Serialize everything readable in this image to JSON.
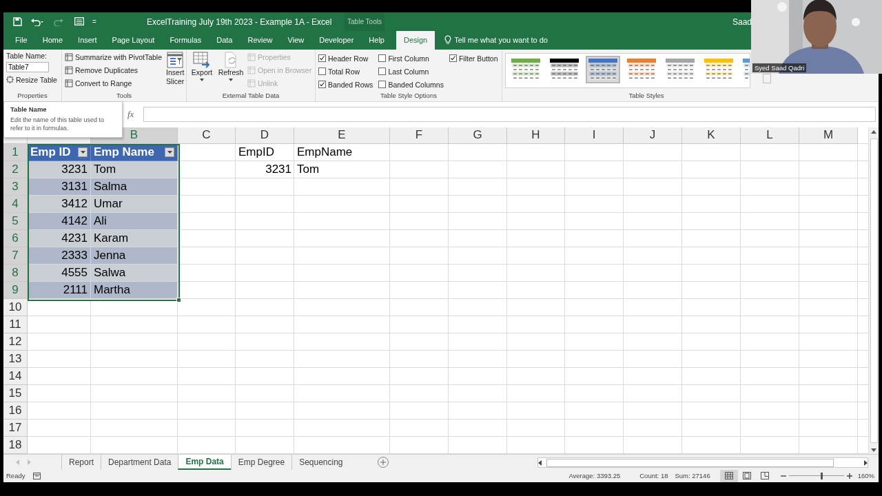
{
  "title_bar": {
    "title": "ExcelTraining July 19th 2023 - Example 1A  -  Excel",
    "context_label": "Table Tools",
    "user": "Saad",
    "customize": "="
  },
  "tabs": [
    {
      "label": "File",
      "selected": false
    },
    {
      "label": "Home",
      "selected": false
    },
    {
      "label": "Insert",
      "selected": false
    },
    {
      "label": "Page Layout",
      "selected": false
    },
    {
      "label": "Formulas",
      "selected": false
    },
    {
      "label": "Data",
      "selected": false
    },
    {
      "label": "Review",
      "selected": false
    },
    {
      "label": "View",
      "selected": false
    },
    {
      "label": "Developer",
      "selected": false
    },
    {
      "label": "Help",
      "selected": false
    },
    {
      "label": "Design",
      "selected": true
    }
  ],
  "tell_me": "Tell me what you want to do",
  "ribbon": {
    "properties": {
      "label": "Table Name:",
      "table_name": "Table7",
      "resize": "Resize Table",
      "group": "Properties"
    },
    "tools": {
      "buttons": [
        "Summarize with PivotTable",
        "Remove Duplicates",
        "Convert to Range"
      ],
      "slicer": "Insert Slicer",
      "group": "Tools"
    },
    "external": {
      "export": "Export",
      "refresh": "Refresh",
      "buttons": [
        {
          "label": "Properties",
          "disabled": true
        },
        {
          "label": "Open in Browser",
          "disabled": true
        },
        {
          "label": "Unlink",
          "disabled": true
        }
      ],
      "group": "External Table Data"
    },
    "style_options": {
      "options": [
        {
          "label": "Header Row",
          "checked": true
        },
        {
          "label": "Total Row",
          "checked": false
        },
        {
          "label": "Banded Rows",
          "checked": true
        },
        {
          "label": "First Column",
          "checked": false
        },
        {
          "label": "Last Column",
          "checked": false
        },
        {
          "label": "Banded Columns",
          "checked": false
        },
        {
          "label": "Filter Button",
          "checked": true
        }
      ],
      "group": "Table Style Options"
    },
    "table_styles": {
      "items": [
        {
          "color": "#70ad47",
          "selected": false
        },
        {
          "color": "#000000",
          "selected": false
        },
        {
          "color": "#4472c4",
          "selected": true
        },
        {
          "color": "#ed7d31",
          "selected": false
        },
        {
          "color": "#a5a5a5",
          "selected": false
        },
        {
          "color": "#ffc000",
          "selected": false
        },
        {
          "color": "#5b9bd5",
          "selected": false
        }
      ],
      "group": "Table Styles"
    }
  },
  "tooltip": {
    "title": "Table Name",
    "text": "Edit the name of this table used to refer to it in formulas."
  },
  "formula_bar": {
    "fx": "fx"
  },
  "sheet": {
    "columns": [
      {
        "label": "B",
        "selected": true
      },
      {
        "label": "C",
        "selected": false
      },
      {
        "label": "D",
        "selected": false,
        "cells": [
          {
            "text": "EmpID",
            "kind": "text"
          },
          {
            "text": "3231",
            "kind": "number"
          }
        ]
      },
      {
        "label": "E",
        "selected": false,
        "cells": [
          {
            "text": "EmpName",
            "kind": "text"
          },
          {
            "text": "Tom",
            "kind": "text"
          }
        ]
      },
      {
        "label": "F",
        "selected": false
      },
      {
        "label": "G",
        "selected": false
      },
      {
        "label": "H",
        "selected": false
      },
      {
        "label": "I",
        "selected": false
      },
      {
        "label": "J",
        "selected": false
      },
      {
        "label": "K",
        "selected": false
      },
      {
        "label": "L",
        "selected": false
      },
      {
        "label": "M",
        "selected": false
      }
    ],
    "rows": [
      {
        "label": "1",
        "selected": true
      },
      {
        "label": "2",
        "selected": true
      },
      {
        "label": "3",
        "selected": true
      },
      {
        "label": "4",
        "selected": true
      },
      {
        "label": "5",
        "selected": true
      },
      {
        "label": "6",
        "selected": true
      },
      {
        "label": "7",
        "selected": true
      },
      {
        "label": "8",
        "selected": true
      },
      {
        "label": "9",
        "selected": true
      },
      {
        "label": "10",
        "selected": false
      },
      {
        "label": "11",
        "selected": false
      },
      {
        "label": "12",
        "selected": false
      },
      {
        "label": "13",
        "selected": false
      },
      {
        "label": "14",
        "selected": false
      },
      {
        "label": "15",
        "selected": false
      },
      {
        "label": "16",
        "selected": false
      },
      {
        "label": "17",
        "selected": false
      },
      {
        "label": "18",
        "selected": false
      }
    ],
    "table": {
      "headers": [
        "Emp ID",
        "Emp Name"
      ],
      "rows": [
        [
          "3231",
          "Tom"
        ],
        [
          "3131",
          "Salma"
        ],
        [
          "3412",
          "Umar"
        ],
        [
          "4142",
          "Ali"
        ],
        [
          "4231",
          "Karam"
        ],
        [
          "2333",
          "Jenna"
        ],
        [
          "4555",
          "Salwa"
        ],
        [
          "2111",
          "Martha"
        ]
      ]
    }
  },
  "sheet_tabs": [
    {
      "label": "Report",
      "selected": false
    },
    {
      "label": "Department Data",
      "selected": false
    },
    {
      "label": "Emp Data",
      "selected": true
    },
    {
      "label": "Emp Degree",
      "selected": false
    },
    {
      "label": "Sequencing",
      "selected": false
    }
  ],
  "status_bar": {
    "ready": "Ready",
    "average": "Average: 3393.25",
    "count": "Count: 18",
    "sum": "Sum: 27146",
    "zoom": "160%",
    "zoom_slider": {
      "level": 0.6
    }
  },
  "webcam": {
    "name": "Syed Saad Qadri"
  }
}
